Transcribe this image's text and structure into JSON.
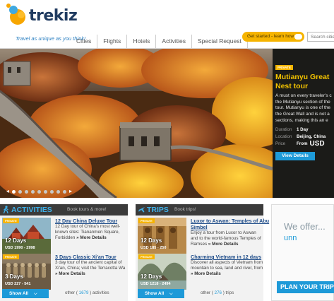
{
  "brand": {
    "name": "trekiz",
    "tagline": "Travel as unique as you think!"
  },
  "nav": {
    "items": [
      "Cities",
      "Flights",
      "Hotels",
      "Activities",
      "Special Request"
    ]
  },
  "header": {
    "get_started_label": "Get started - learn how",
    "search_placeholder": "Search citie"
  },
  "hero": {
    "badge": "PRIVATE",
    "title_line1": "Mutianyu Great",
    "title_line2": "Nest tour",
    "desc_lines": [
      "A must on every traveler's c",
      "the Mutianyu section of the",
      "tour. Mutianyu is one of the",
      "the Great Wall and is not a",
      "sections, making this an e"
    ],
    "duration_label": "Duration",
    "duration_value": "1 Day",
    "location_label": "Location",
    "location_value": "Beijing, China",
    "price_label": "Price",
    "price_from": "From",
    "price_value": "USD",
    "view_details_label": "View Details",
    "slide_count": 9,
    "active_slide": 1
  },
  "activities": {
    "title": "ACTIVITIES",
    "more_label": "Book tours & more!",
    "items": [
      {
        "badge": "PRIVATE",
        "days": "12 Days",
        "price": "USD 1990 - 2998",
        "title": "12 Day China Deluxe Tour",
        "desc": "12 Day tour of China's most well-known sites: Tiananmen Square, Forbidden",
        "more": "» More Details"
      },
      {
        "badge": "PRIVATE",
        "days": "3 Days",
        "price": "USD 227 - 541",
        "title": "3 Days Classic Xi'an Tour",
        "desc": "3 day tour of the ancient capital of Xi'an, China; visit the Terracotta Wa",
        "more": "» More Details"
      }
    ],
    "show_all_label": "Show All",
    "other_prefix": "other (",
    "other_count": "1679",
    "other_suffix": ") activities"
  },
  "trips": {
    "title": "TRIPS",
    "more_label": "Book trips!",
    "items": [
      {
        "badge": "PRIVATE",
        "days": "12 Days",
        "price": "USD 185 - 250",
        "title_line1": "Luxor to Aswan: Temples of Abu",
        "title_line2": "Simbel",
        "desc": "Enjoy a tour from Luxor to Aswan and to the world-famous Temples of Ramses",
        "more": "» More Details"
      },
      {
        "badge": "PRIVATE",
        "days": "12 Days",
        "price": "USD 1218 - 2494",
        "title": "Charming Vietnam in 12 days",
        "desc": "Discover all aspects of Vietnam from mountain to sea, land and river, from",
        "more": "» More Details"
      }
    ],
    "show_all_label": "Show All",
    "other_prefix": "other (",
    "other_count": "276",
    "other_suffix": ") trips"
  },
  "offer": {
    "title": "We offer...",
    "value": "unn",
    "button_label": "PLAN YOUR TRIP"
  },
  "colors": {
    "accent_blue": "#1e9ad8",
    "accent_yellow": "#f6b400",
    "panel_header": "#3b3b3b",
    "link_blue": "#1f4d8a"
  }
}
